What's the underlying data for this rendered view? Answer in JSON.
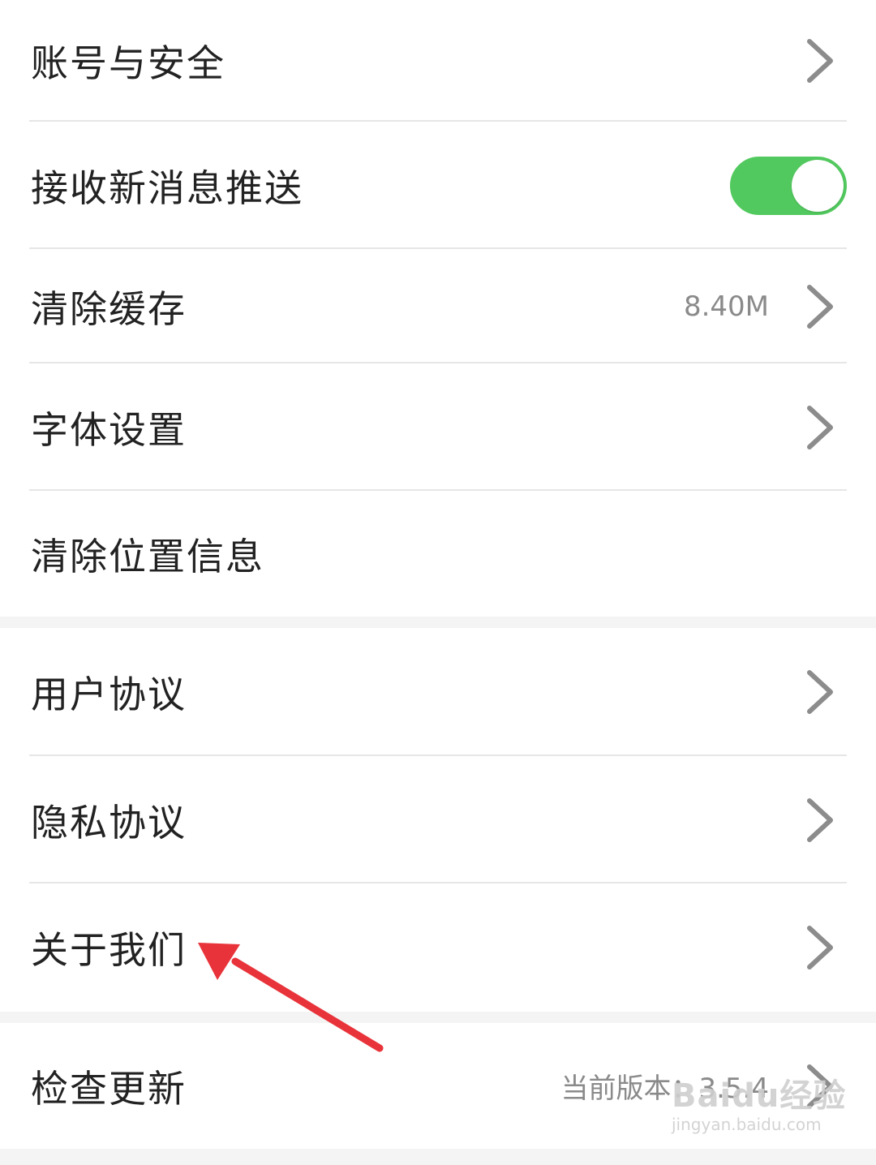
{
  "colors": {
    "toggle_on": "#52c95e",
    "arrow": "#e8333a",
    "chevron": "#8c8c8c"
  },
  "settings": {
    "account_security": {
      "label": "账号与安全",
      "icon": "chevron-right-icon"
    },
    "push_notifications": {
      "label": "接收新消息推送",
      "enabled": true
    },
    "clear_cache": {
      "label": "清除缓存",
      "value": "8.40M",
      "icon": "chevron-right-icon"
    },
    "font_settings": {
      "label": "字体设置",
      "icon": "chevron-right-icon"
    },
    "clear_location": {
      "label": "清除位置信息"
    },
    "user_agreement": {
      "label": "用户协议",
      "icon": "chevron-right-icon"
    },
    "privacy_agreement": {
      "label": "隐私协议",
      "icon": "chevron-right-icon"
    },
    "about_us": {
      "label": "关于我们",
      "icon": "chevron-right-icon"
    },
    "check_update": {
      "label": "检查更新",
      "value": "当前版本：3.5.4",
      "icon": "chevron-right-icon"
    }
  },
  "watermark": {
    "line1": "Baidu经验",
    "line2": "jingyan.baidu.com"
  }
}
